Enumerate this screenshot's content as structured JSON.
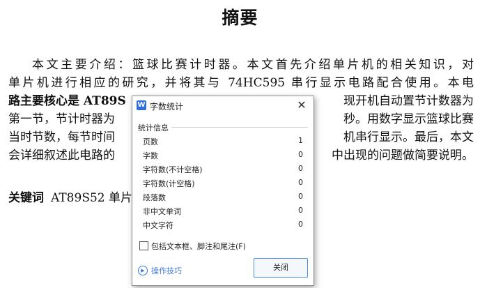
{
  "document": {
    "title": "摘要",
    "abstract_lines": [
      "本文主要介绍：篮球比赛计时器。本文首先介绍单片机的相关知识，对",
      "单片机进行相应的研究，并将其与 74HC595 串行显示电路配合使用。本电",
      "路主要核心是 AT89S",
      "第一节，节计时器为",
      "当时节数，每节时间",
      "会详细叙述此电路的"
    ],
    "abstract_tails": [
      "",
      "",
      "现开机自动置节计数器为",
      "秒。用数字显示篮球比赛",
      "机串行显示。最后，本文",
      "中出现的问题做简要说明。"
    ],
    "keywords_label": "关键词",
    "keywords_text": "AT89S52 单片"
  },
  "dialog": {
    "title": "字数统计",
    "app_icon_text": "W",
    "section_label": "统计信息",
    "stats": [
      {
        "label": "页数",
        "value": "1"
      },
      {
        "label": "字数",
        "value": "0"
      },
      {
        "label": "字符数(不计空格)",
        "value": "0"
      },
      {
        "label": "字符数(计空格)",
        "value": "0"
      },
      {
        "label": "段落数",
        "value": "0"
      },
      {
        "label": "非中文单词",
        "value": "0"
      },
      {
        "label": "中文字符",
        "value": "0"
      }
    ],
    "checkbox_label": "包括文本框、脚注和尾注(F)",
    "checkbox_checked": false,
    "tips_label": "操作技巧",
    "close_button_label": "关闭",
    "close_icon": "close-icon",
    "accent_color": "#3b78d8"
  }
}
